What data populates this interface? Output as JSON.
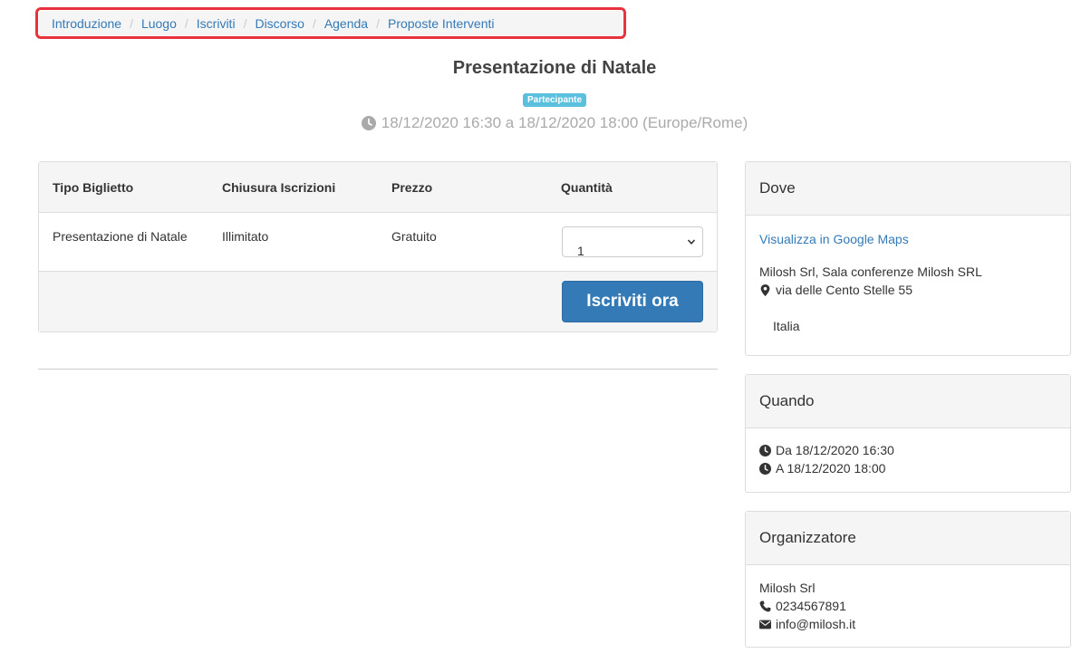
{
  "breadcrumb": {
    "items": [
      "Introduzione",
      "Luogo",
      "Iscriviti",
      "Discorso",
      "Agenda",
      "Proposte Interventi"
    ],
    "separator": "/"
  },
  "event": {
    "title": "Presentazione di Natale",
    "badge": "Partecipante",
    "datetime": "18/12/2020 16:30 a 18/12/2020 18:00 (Europe/Rome)"
  },
  "tickets": {
    "headers": [
      "Tipo Biglietto",
      "Chiusura Iscrizioni",
      "Prezzo",
      "Quantità"
    ],
    "row": {
      "type": "Presentazione di Natale",
      "closing": "Illimitato",
      "price": "Gratuito",
      "quantity": "1"
    },
    "register_label": "Iscriviti ora"
  },
  "where": {
    "title": "Dove",
    "maps_link": "Visualizza in Google Maps",
    "venue": "Milosh Srl, Sala conferenze Milosh SRL",
    "street": "via delle Cento Stelle 55",
    "country": "Italia"
  },
  "when": {
    "title": "Quando",
    "from": "Da 18/12/2020 16:30",
    "to": "A 18/12/2020 18:00"
  },
  "organizer": {
    "title": "Organizzatore",
    "name": "Milosh Srl",
    "phone": "0234567891",
    "email": "info@milosh.it"
  },
  "colors": {
    "link": "#337ab7",
    "badge": "#5bc0de",
    "button": "#337ab7",
    "highlight": "#e8333e"
  },
  "icons": [
    "clock-icon",
    "chevron-down-icon",
    "map-marker-icon",
    "phone-icon",
    "envelope-icon"
  ]
}
